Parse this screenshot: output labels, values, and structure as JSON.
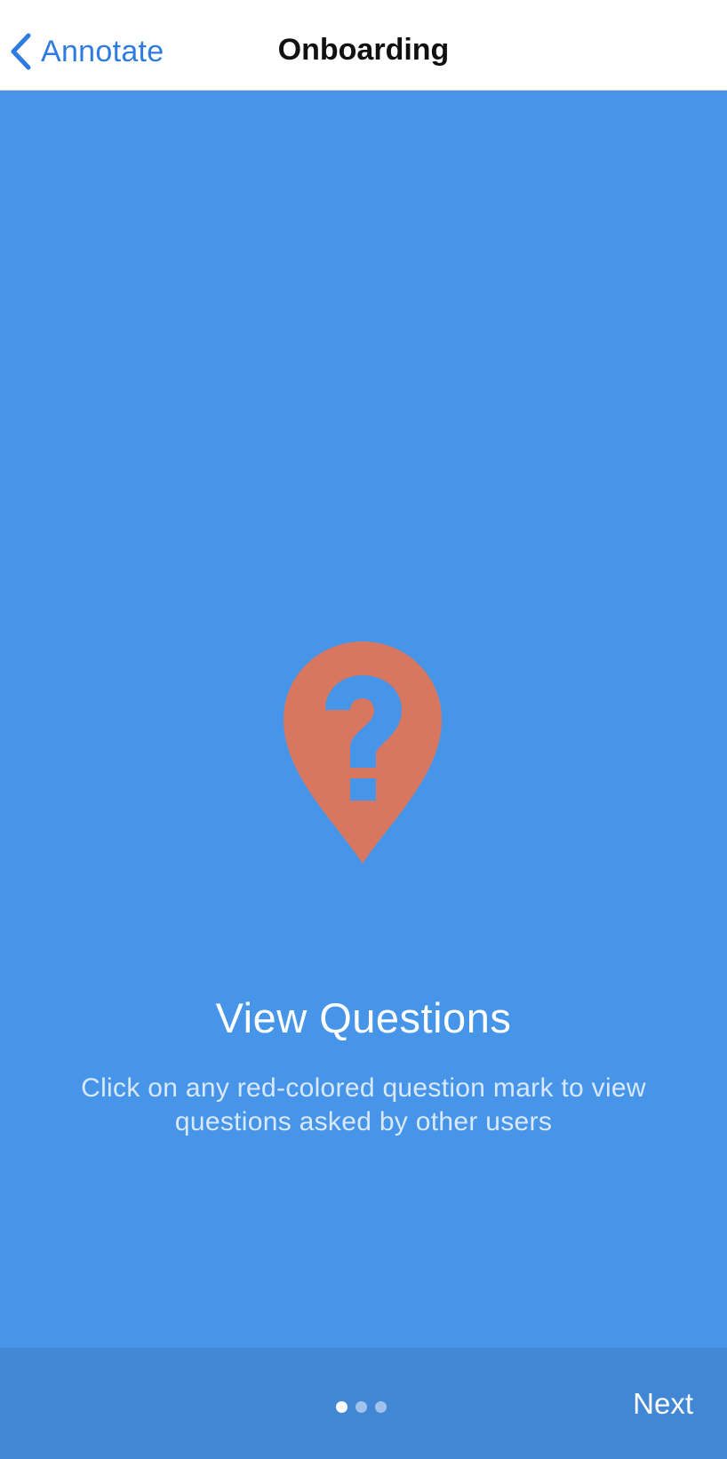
{
  "nav": {
    "back_label": "Annotate",
    "title": "Onboarding"
  },
  "slide": {
    "icon": "question-pin-icon",
    "icon_color": "#D7775F",
    "title": "View Questions",
    "description": "Click on any red-colored question mark to view questions asked by other users"
  },
  "pager": {
    "total_pages": 3,
    "current_page": 1
  },
  "footer": {
    "next_label": "Next"
  },
  "colors": {
    "background": "#4795E9",
    "bottom_bar": "#4287D6",
    "nav_accent": "#2E7BE2"
  }
}
